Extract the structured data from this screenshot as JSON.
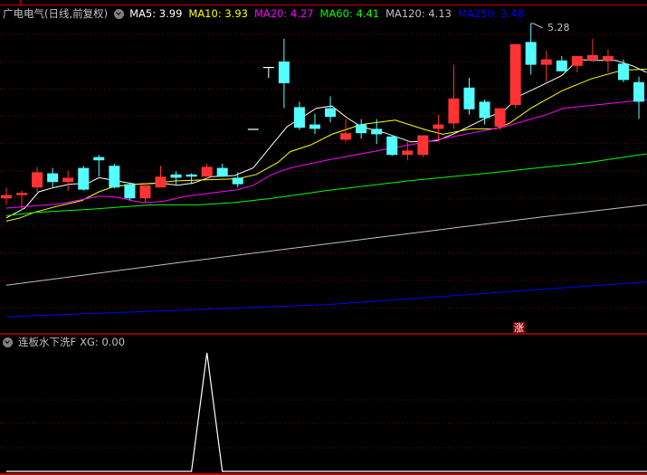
{
  "header": {
    "stock_title": "广电电气(日线,前复权)",
    "ma": [
      {
        "label": "MA5: 3.99",
        "color": "#ffffff"
      },
      {
        "label": "MA10: 3.93",
        "color": "#ffff00"
      },
      {
        "label": "MA20: 4.27",
        "color": "#ff00ff"
      },
      {
        "label": "MA60: 4.41",
        "color": "#00ff00"
      },
      {
        "label": "MA120: 4.13",
        "color": "#c0c0c0"
      },
      {
        "label": "MA250: 3.48",
        "color": "#0000ff"
      }
    ]
  },
  "indicator": {
    "title": "连板水下洗F",
    "value_label": "XG: 0.00"
  },
  "badge": "涨",
  "high_label": "5.28",
  "colors": {
    "up": "#ff3333",
    "down": "#54ffff",
    "grid": "#8b0000",
    "separator": "#c00000"
  },
  "chart_data": [
    {
      "type": "candlestick",
      "title": "广电电气(日线,前复权)",
      "yrange": [
        2.5,
        5.45
      ],
      "max_marker": 5.28,
      "ohlc": [
        [
          3.67,
          3.77,
          3.61,
          3.7
        ],
        [
          3.7,
          3.74,
          3.56,
          3.72
        ],
        [
          3.77,
          3.96,
          3.73,
          3.91
        ],
        [
          3.9,
          3.95,
          3.77,
          3.82
        ],
        [
          3.82,
          3.92,
          3.74,
          3.86
        ],
        [
          3.95,
          3.97,
          3.74,
          3.75
        ],
        [
          4.05,
          4.07,
          3.87,
          4.02
        ],
        [
          3.97,
          3.99,
          3.76,
          3.77
        ],
        [
          3.8,
          3.81,
          3.65,
          3.67
        ],
        [
          3.67,
          3.79,
          3.63,
          3.79
        ],
        [
          3.77,
          3.97,
          3.77,
          3.87
        ],
        [
          3.89,
          3.92,
          3.8,
          3.86
        ],
        [
          3.89,
          3.9,
          3.8,
          3.87
        ],
        [
          3.87,
          3.99,
          3.87,
          3.96
        ],
        [
          3.95,
          3.99,
          3.87,
          3.87
        ],
        [
          3.86,
          3.91,
          3.77,
          3.8
        ],
        [
          4.31,
          4.31,
          4.31,
          4.31
        ],
        [
          4.88,
          4.88,
          4.78,
          4.88
        ],
        [
          4.93,
          5.14,
          4.5,
          4.73
        ],
        [
          4.51,
          4.56,
          4.3,
          4.32
        ],
        [
          4.35,
          4.45,
          4.26,
          4.31
        ],
        [
          4.5,
          4.61,
          4.37,
          4.42
        ],
        [
          4.21,
          4.4,
          4.19,
          4.27
        ],
        [
          4.35,
          4.4,
          4.22,
          4.27
        ],
        [
          4.31,
          4.4,
          4.17,
          4.26
        ],
        [
          4.24,
          4.25,
          4.06,
          4.07
        ],
        [
          4.07,
          4.19,
          4.02,
          4.11
        ],
        [
          4.07,
          4.25,
          4.05,
          4.25
        ],
        [
          4.31,
          4.44,
          4.19,
          4.35
        ],
        [
          4.36,
          4.9,
          4.31,
          4.59
        ],
        [
          4.69,
          4.78,
          4.44,
          4.49
        ],
        [
          4.56,
          4.58,
          4.35,
          4.41
        ],
        [
          4.33,
          4.5,
          4.3,
          4.5
        ],
        [
          4.53,
          5.09,
          4.5,
          5.09
        ],
        [
          5.11,
          5.28,
          4.81,
          4.9
        ],
        [
          4.9,
          5.03,
          4.74,
          4.95
        ],
        [
          4.94,
          4.98,
          4.84,
          4.84
        ],
        [
          4.89,
          4.98,
          4.83,
          4.98
        ],
        [
          4.94,
          5.14,
          4.94,
          4.99
        ],
        [
          4.94,
          5.04,
          4.83,
          4.98
        ],
        [
          4.91,
          4.95,
          4.74,
          4.76
        ],
        [
          4.74,
          4.79,
          4.4,
          4.56
        ]
      ],
      "ma_series": [
        {
          "name": "MA5",
          "color": "#ffffff",
          "points": [
            [
              0,
              3.49
            ],
            [
              1.2,
              3.58
            ],
            [
              2.1,
              3.73
            ],
            [
              3.1,
              3.77
            ],
            [
              4.1,
              3.8
            ],
            [
              5.3,
              3.81
            ],
            [
              6,
              3.86
            ],
            [
              7.2,
              3.83
            ],
            [
              8.4,
              3.8
            ],
            [
              10,
              3.81
            ],
            [
              11.1,
              3.79
            ],
            [
              12.1,
              3.81
            ],
            [
              13.3,
              3.87
            ],
            [
              14.8,
              3.88
            ],
            [
              16,
              3.95
            ],
            [
              17.2,
              4.16
            ],
            [
              18.2,
              4.33
            ],
            [
              20.1,
              4.5
            ],
            [
              21.1,
              4.52
            ],
            [
              22.1,
              4.41
            ],
            [
              23,
              4.33
            ],
            [
              24.6,
              4.27
            ],
            [
              26.2,
              4.19
            ],
            [
              27.9,
              4.2
            ],
            [
              29.1,
              4.27
            ],
            [
              31.1,
              4.41
            ],
            [
              32.3,
              4.48
            ],
            [
              33.2,
              4.61
            ],
            [
              34.4,
              4.69
            ],
            [
              36,
              4.8
            ],
            [
              37.1,
              4.95
            ],
            [
              37.9,
              4.94
            ],
            [
              39.5,
              4.94
            ],
            [
              40.6,
              4.89
            ],
            [
              41.5,
              4.83
            ]
          ]
        },
        {
          "name": "MA10",
          "color": "#ffff00",
          "points": [
            [
              0,
              3.46
            ],
            [
              0.9,
              3.49
            ],
            [
              1.8,
              3.54
            ],
            [
              3.1,
              3.59
            ],
            [
              4.9,
              3.65
            ],
            [
              6,
              3.73
            ],
            [
              7,
              3.78
            ],
            [
              8.4,
              3.8
            ],
            [
              9.7,
              3.81
            ],
            [
              10.9,
              3.83
            ],
            [
              12.9,
              3.84
            ],
            [
              15,
              3.85
            ],
            [
              16.2,
              3.89
            ],
            [
              17.6,
              4.0
            ],
            [
              18.4,
              4.1
            ],
            [
              19.7,
              4.16
            ],
            [
              21.1,
              4.26
            ],
            [
              23,
              4.35
            ],
            [
              25.2,
              4.39
            ],
            [
              27.2,
              4.3
            ],
            [
              28.3,
              4.26
            ],
            [
              30.1,
              4.31
            ],
            [
              31.7,
              4.31
            ],
            [
              32.6,
              4.36
            ],
            [
              34,
              4.5
            ],
            [
              36,
              4.66
            ],
            [
              37.9,
              4.77
            ],
            [
              39.9,
              4.85
            ],
            [
              41.5,
              4.86
            ]
          ]
        },
        {
          "name": "MA20",
          "color": "#ff00ff",
          "points": [
            [
              0,
              3.58
            ],
            [
              1.8,
              3.6
            ],
            [
              3.5,
              3.62
            ],
            [
              5.3,
              3.67
            ],
            [
              6,
              3.69
            ],
            [
              7.2,
              3.68
            ],
            [
              8.8,
              3.63
            ],
            [
              10.1,
              3.64
            ],
            [
              11.7,
              3.69
            ],
            [
              13.3,
              3.72
            ],
            [
              15,
              3.75
            ],
            [
              16,
              3.79
            ],
            [
              17.2,
              3.89
            ],
            [
              18.4,
              3.95
            ],
            [
              20.7,
              4.02
            ],
            [
              27.2,
              4.19
            ],
            [
              32.3,
              4.33
            ],
            [
              35,
              4.44
            ],
            [
              36.1,
              4.5
            ],
            [
              38.9,
              4.54
            ],
            [
              41.5,
              4.58
            ]
          ]
        },
        {
          "name": "MA60",
          "color": "#00ff00",
          "points": [
            [
              0,
              3.51
            ],
            [
              1.9,
              3.54
            ],
            [
              5.5,
              3.57
            ],
            [
              9.4,
              3.61
            ],
            [
              12.5,
              3.61
            ],
            [
              14.7,
              3.63
            ],
            [
              17.2,
              3.67
            ],
            [
              20.7,
              3.74
            ],
            [
              26,
              3.83
            ],
            [
              31.8,
              3.91
            ],
            [
              37.7,
              4.0
            ],
            [
              41.5,
              4.08
            ]
          ]
        },
        {
          "name": "MA120",
          "color": "#c0c0c0",
          "points": [
            [
              0,
              2.87
            ],
            [
              11.3,
              3.08
            ],
            [
              23,
              3.29
            ],
            [
              34.8,
              3.5
            ],
            [
              41.5,
              3.61
            ]
          ]
        },
        {
          "name": "MA250",
          "color": "#0000ff",
          "points": [
            [
              0,
              2.58
            ],
            [
              20.7,
              2.69
            ],
            [
              41.5,
              2.9
            ]
          ]
        }
      ]
    },
    {
      "type": "line",
      "title": "连板水下洗F",
      "series": [
        {
          "name": "XG",
          "color": "#ffffff",
          "values": [
            0,
            0,
            0,
            0,
            0,
            0,
            0,
            0,
            0,
            0,
            0,
            0,
            0,
            1,
            0,
            0,
            0,
            0,
            0,
            0,
            0,
            0,
            0,
            0,
            0,
            0,
            0,
            0,
            0,
            0,
            0,
            0,
            0,
            0,
            0,
            0,
            0,
            0,
            0,
            0,
            0,
            0
          ]
        }
      ],
      "yrange": [
        0,
        1
      ]
    }
  ]
}
